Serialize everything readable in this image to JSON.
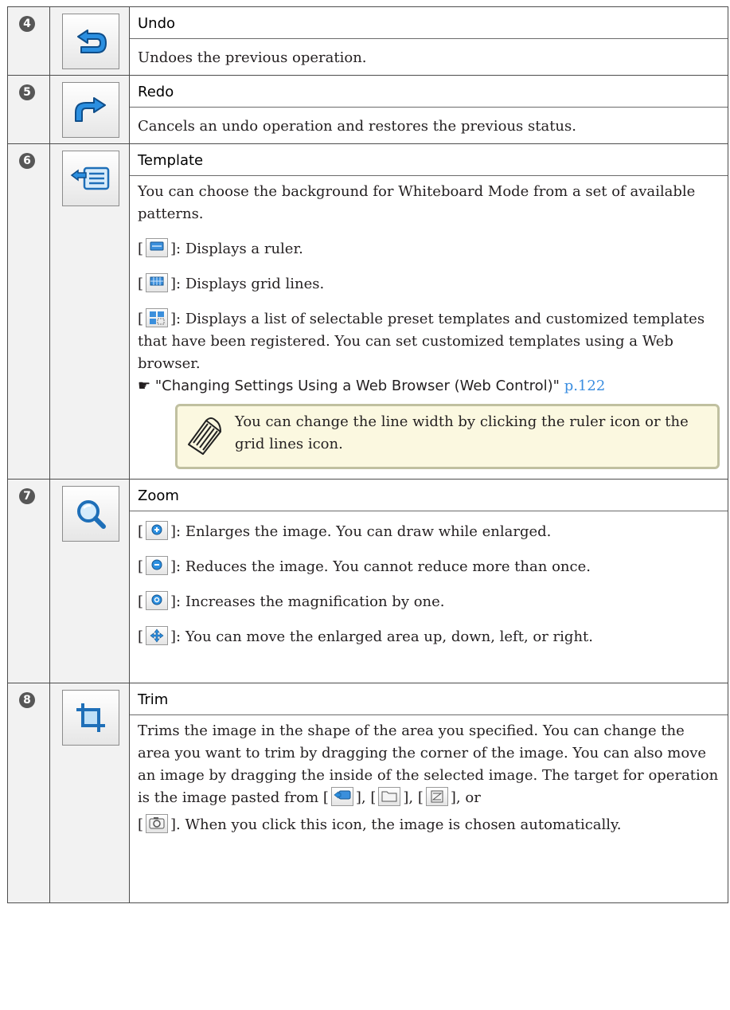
{
  "rows": [
    {
      "number": "4",
      "icon": "undo-arrow-icon",
      "title": "Undo",
      "text": "Undoes the previous operation."
    },
    {
      "number": "5",
      "icon": "redo-arrow-icon",
      "title": "Redo",
      "text": "Cancels an undo operation and restores the previous status."
    },
    {
      "number": "6",
      "icon": "template-icon",
      "title": "Template",
      "intro": "You can choose the background for Whiteboard Mode from a set of available patterns.",
      "item_ruler": "]: Displays a ruler.",
      "item_grid": "]: Displays grid lines.",
      "item_list": "]: Displays a list of selectable preset templates and customized templates that have been registered. You can set customized templates using a Web browser.",
      "ref_symbol": "☛",
      "ref_text": "\"Changing Settings Using a Web Browser (Web Control)\"",
      "ref_page": "p.122",
      "note": "You can change the line width by clicking the ruler icon or the grid lines icon."
    },
    {
      "number": "7",
      "icon": "zoom-magnifier-icon",
      "title": "Zoom",
      "item_enlarge": "]: Enlarges the image. You can draw while enlarged.",
      "item_reduce": "]: Reduces the image. You cannot reduce more than once.",
      "item_increase": "]: Increases the magnification by one.",
      "item_move": "]: You can move the enlarged area up, down, left, or right."
    },
    {
      "number": "8",
      "icon": "trim-crop-icon",
      "title": "Trim",
      "text1": "Trims the image in the shape of the area you specified. You can change the area you want to trim by dragging the corner of the image. You can also move an image by dragging the inside of the selected image. The target for operation is the image pasted from [",
      "sep1": "], [",
      "sep2": "], [",
      "sep3": "], or",
      "text2": "]. When you click this icon, the image is chosen automatically."
    }
  ],
  "bracket_open": "[",
  "colors": {
    "circle": "#575757",
    "icon_blue": "#1e7fd0",
    "link": "#3a8de0",
    "note_bg": "#fbf8e0"
  }
}
